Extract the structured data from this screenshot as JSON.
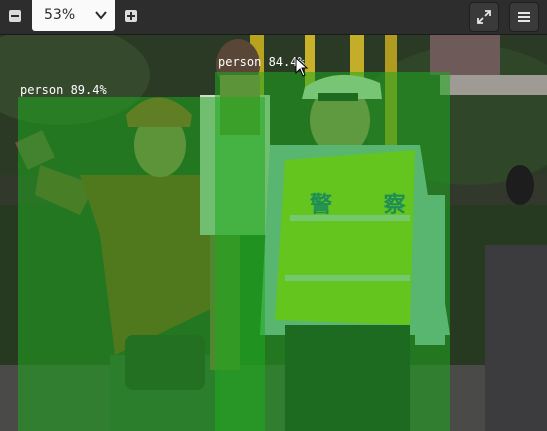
{
  "toolbar": {
    "zoom_value": "53%",
    "zoom_out_icon": "minus-square-icon",
    "zoom_in_icon": "plus-square-icon",
    "fullscreen_icon": "expand-arrows-icon",
    "menu_icon": "hamburger-menu-icon"
  },
  "detections": [
    {
      "label": "person 89.4%"
    },
    {
      "label": "person 84.4%"
    }
  ],
  "vest_text": "警 察",
  "colors": {
    "toolbar_bg": "#2d2d2d",
    "detection_overlay": "#1faa1f"
  }
}
